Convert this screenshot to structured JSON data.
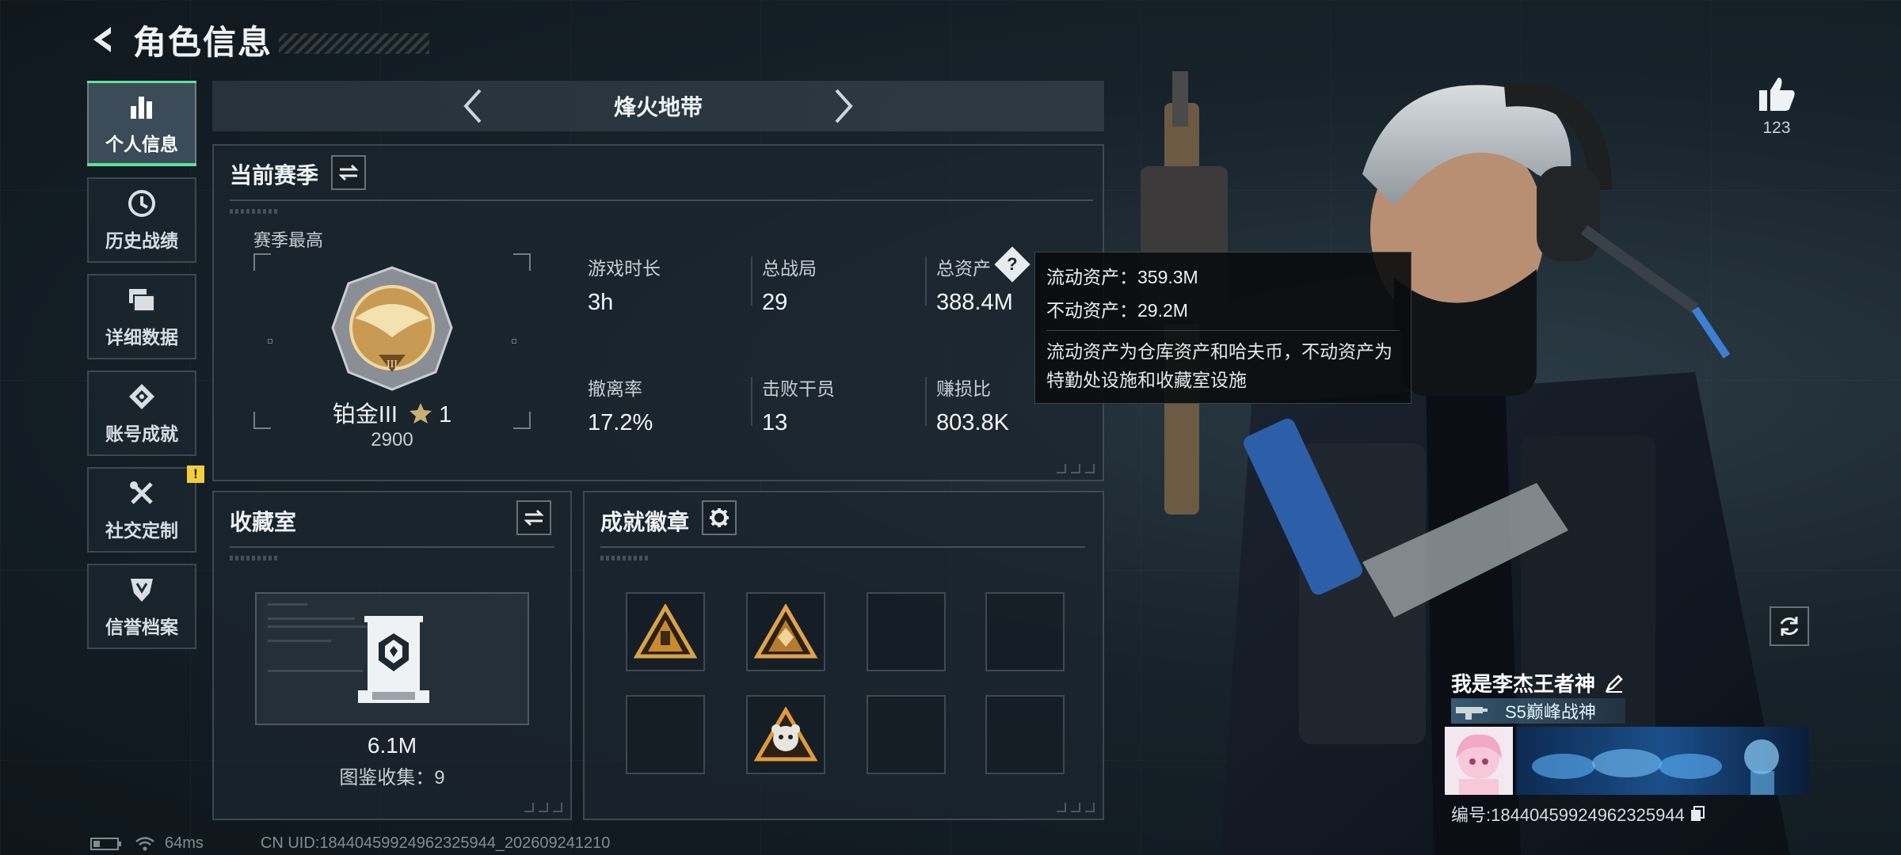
{
  "header": {
    "title": "角色信息"
  },
  "nav": {
    "items": [
      {
        "label": "个人信息",
        "icon": "bar-chart-icon",
        "active": true
      },
      {
        "label": "历史战绩",
        "icon": "clock-icon"
      },
      {
        "label": "详细数据",
        "icon": "folder-icon"
      },
      {
        "label": "账号成就",
        "icon": "achievement-icon"
      },
      {
        "label": "社交定制",
        "icon": "tools-icon",
        "alert": "!"
      },
      {
        "label": "信誉档案",
        "icon": "credit-shield-icon"
      }
    ]
  },
  "mode": {
    "title": "烽火地带"
  },
  "season": {
    "title": "当前赛季",
    "best_label": "赛季最高",
    "rank_name": "铂金III",
    "rank_stars": "1",
    "rank_score": "2900",
    "stats": [
      {
        "label": "游戏时长",
        "value": "3h"
      },
      {
        "label": "总战局",
        "value": "29"
      },
      {
        "label": "总资产",
        "value": "388.4M"
      },
      {
        "label": "撤离率",
        "value": "17.2%"
      },
      {
        "label": "击败干员",
        "value": "13"
      },
      {
        "label": "赚损比",
        "value": "803.8K"
      }
    ],
    "help_icon": "?"
  },
  "tooltip": {
    "liquid": "流动资产：359.3M",
    "fixed": "不动资产：29.2M",
    "desc": "流动资产为仓库资产和哈夫币，不动资产为特勤处设施和收藏室设施"
  },
  "collection": {
    "title": "收藏室",
    "value": "6.1M",
    "count": "图鉴收集：9"
  },
  "badges": {
    "title": "成就徽章",
    "slots": [
      "gold-triangle-badge",
      "orange-triangle-badge",
      "",
      "",
      "",
      "cartoon-badge",
      "",
      ""
    ]
  },
  "player": {
    "likes": "123",
    "name": "我是李杰王者神",
    "title": "S5巅峰战神",
    "id_text": "编号:18440459924962325944"
  },
  "status": {
    "ping": "64ms",
    "uid": "CN UID:18440459924962325944_202609241210"
  },
  "colors": {
    "accent_green": "#5fe29a",
    "alert_yellow": "#f2cf3b",
    "background": "#17222a"
  }
}
